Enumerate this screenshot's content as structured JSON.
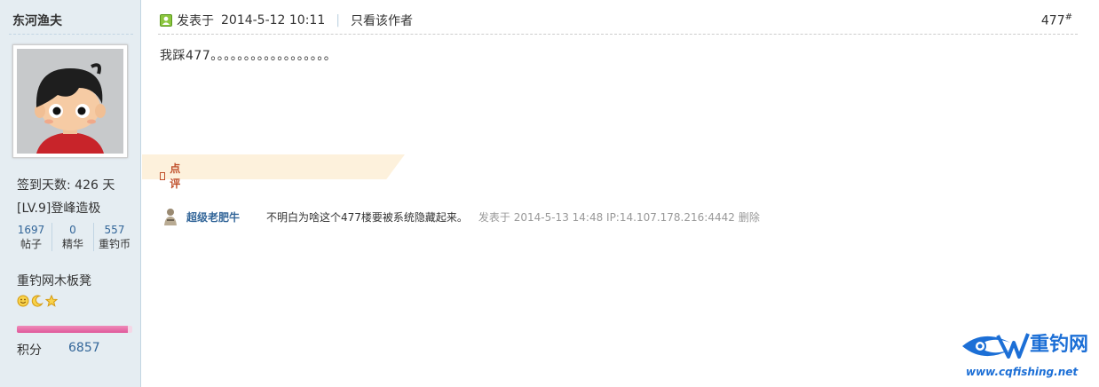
{
  "author": {
    "name": "东河渔夫",
    "signin": "签到天数: 426 天",
    "level": "[LV.9]登峰造极",
    "counts": [
      {
        "value": "1697",
        "label": "帖子"
      },
      {
        "value": "0",
        "label": "精华"
      },
      {
        "value": "557",
        "label": "重钓币"
      }
    ],
    "group": "重钓网木板凳",
    "medals": [
      "smiley-medal-icon",
      "moon-medal-icon",
      "star-medal-icon"
    ],
    "progress_fraction": 0.96,
    "score_label": "积分",
    "score_value": "6857"
  },
  "post": {
    "posted_label": "发表于",
    "posted_time": "2014-5-12 10:11",
    "separator": "|",
    "only_author": "只看该作者",
    "floor": "477",
    "floor_mark": "#",
    "body": "我踩477。。。。。。。。。。。。。。。。。。"
  },
  "comments_section": {
    "label": "点评",
    "items": [
      {
        "user": "超级老肥牛",
        "text": "不明白为啥这个477楼要被系统隐藏起来。",
        "meta": "发表于  2014-5-13 14:48 IP:14.107.178.216:4442",
        "delete": "删除"
      }
    ]
  },
  "watermark": {
    "title": "重钓网",
    "url": "www.cqfishing.net"
  },
  "colors": {
    "sidebar_bg": "#e5edf2",
    "link": "#336699",
    "comment_accent": "#c0502b",
    "banner_bg": "#fdf1dc",
    "watermark": "#1c6fd6"
  }
}
